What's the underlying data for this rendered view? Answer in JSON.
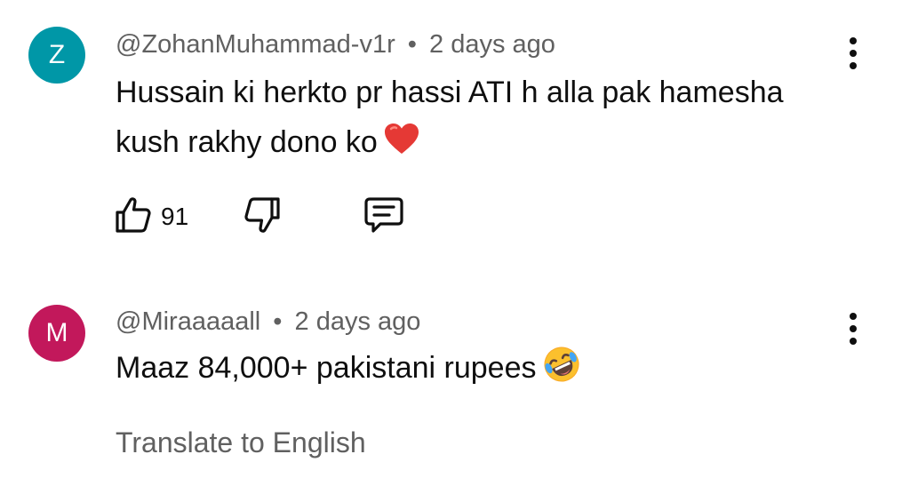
{
  "comments": [
    {
      "avatar_letter": "Z",
      "avatar_color": "#0097a7",
      "author": "@ZohanMuhammad-v1r",
      "separator": "•",
      "time": "2 days ago",
      "text": "Hussain ki herkto pr hassi ATI h alla pak hamesha kush rakhy dono ko",
      "emoji": "heart-emoji",
      "like_count": "91",
      "icons": [
        "thumbs-up-icon",
        "thumbs-down-icon",
        "reply-icon",
        "more-vert-icon"
      ]
    },
    {
      "avatar_letter": "M",
      "avatar_color": "#c2185b",
      "author": "@Miraaaaall",
      "separator": "•",
      "time": "2 days ago",
      "text": "Maaz 84,000+ pakistani rupees",
      "emoji": "rolling-on-floor-laughing-emoji",
      "translate_label": "Translate to English",
      "icons": [
        "more-vert-icon"
      ]
    }
  ]
}
